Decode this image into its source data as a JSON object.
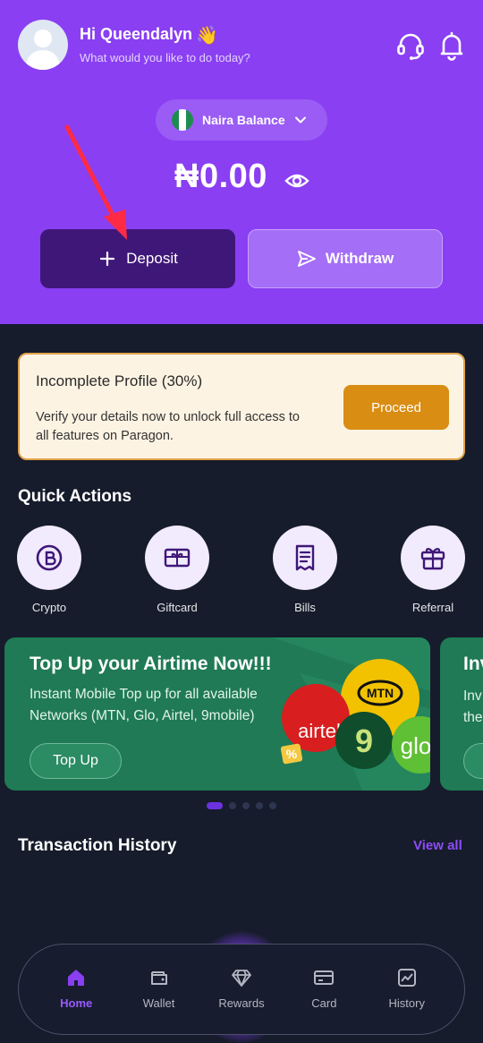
{
  "header": {
    "greeting": "Hi Queendalyn",
    "wave_emoji": "👋",
    "subtitle": "What would you like to do today?",
    "icons": [
      "support-headset-icon",
      "bell-icon"
    ]
  },
  "balance": {
    "currency_label": "Naira Balance",
    "amount": "₦0.00",
    "flag_colors": [
      "#1e8c4e",
      "#ffffff",
      "#1e8c4e"
    ]
  },
  "actions": {
    "deposit_label": "Deposit",
    "withdraw_label": "Withdraw"
  },
  "profile_card": {
    "title": "Incomplete Profile (30%)",
    "description": "Verify your details now to unlock full access to all features on Paragon.",
    "button_label": "Proceed",
    "progress_percent": 30
  },
  "quick_actions": {
    "title": "Quick Actions",
    "items": [
      {
        "label": "Crypto",
        "icon": "crypto-coin-icon"
      },
      {
        "label": "Giftcard",
        "icon": "giftcard-icon"
      },
      {
        "label": "Bills",
        "icon": "bills-receipt-icon"
      },
      {
        "label": "Referral",
        "icon": "gift-box-icon"
      }
    ]
  },
  "banner": {
    "title": "Top Up your Airtime Now!!!",
    "text": "Instant Mobile Top up for all available Networks (MTN, Glo, Airtel, 9mobile)",
    "button_label": "Top Up",
    "next_banner_peek_title": "Inv",
    "next_banner_peek_text_1": "Inv",
    "next_banner_peek_text_2": "the",
    "network_logos": [
      "MTN",
      "airtel",
      "9",
      "glo"
    ],
    "active_slide": 1,
    "slide_count": 5
  },
  "transactions": {
    "title": "Transaction History",
    "view_all_label": "View all"
  },
  "bottom_nav": {
    "items": [
      {
        "label": "Home",
        "icon": "home-icon",
        "active": true
      },
      {
        "label": "Wallet",
        "icon": "wallet-icon",
        "active": false
      },
      {
        "label": "Rewards",
        "icon": "diamond-icon",
        "active": false
      },
      {
        "label": "Card",
        "icon": "credit-card-icon",
        "active": false
      },
      {
        "label": "History",
        "icon": "chart-icon",
        "active": false
      }
    ]
  },
  "colors": {
    "brand_purple": "#8a3ff2",
    "deposit_button": "#3f1778",
    "proceed_button": "#d98d13",
    "banner_green": "#1f7a55",
    "background": "#161c2b"
  }
}
